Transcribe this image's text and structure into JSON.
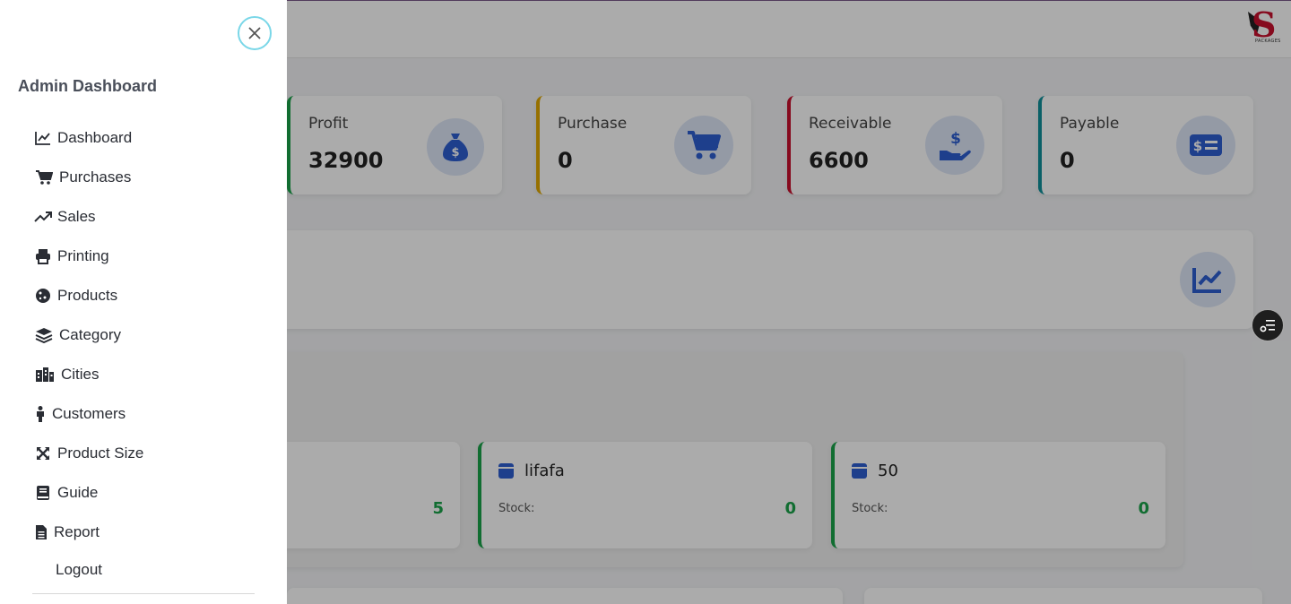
{
  "header": {
    "logo_text": "S",
    "logo_subtext": "PACKAGES"
  },
  "stats": [
    {
      "label": "Profit",
      "value": "32900",
      "accent": "#1aa34a",
      "icon": "money-bag-icon"
    },
    {
      "label": "Purchase",
      "value": "0",
      "accent": "#e0a800",
      "icon": "cart-icon"
    },
    {
      "label": "Receivable",
      "value": "6600",
      "accent": "#c8102e",
      "icon": "hand-dollar-icon"
    },
    {
      "label": "Payable",
      "value": "0",
      "accent": "#0f8f9a",
      "icon": "money-bill-icon"
    }
  ],
  "products": [
    {
      "name": "",
      "stock_label": "",
      "stock": "5"
    },
    {
      "name": "lifafa",
      "stock_label": "Stock:",
      "stock": "0"
    },
    {
      "name": "50",
      "stock_label": "Stock:",
      "stock": "0"
    }
  ],
  "sidebar": {
    "title": "Admin Dashboard",
    "items": [
      {
        "label": "Dashboard",
        "icon": "line-chart-icon"
      },
      {
        "label": "Purchases",
        "icon": "cart-icon"
      },
      {
        "label": "Sales",
        "icon": "trend-up-icon"
      },
      {
        "label": "Printing",
        "icon": "printer-icon"
      },
      {
        "label": "Products",
        "icon": "cookie-icon"
      },
      {
        "label": "Category",
        "icon": "layers-icon"
      },
      {
        "label": "Cities",
        "icon": "city-icon"
      },
      {
        "label": "Customers",
        "icon": "person-icon"
      },
      {
        "label": "Product Size",
        "icon": "expand-icon"
      },
      {
        "label": "Guide",
        "icon": "book-icon"
      },
      {
        "label": "Report",
        "icon": "file-icon"
      }
    ],
    "logout_label": "Logout"
  },
  "colors": {
    "brand_blue": "#2e5fd1",
    "success": "#1aa34a",
    "close_ring": "#7ad7e8"
  }
}
